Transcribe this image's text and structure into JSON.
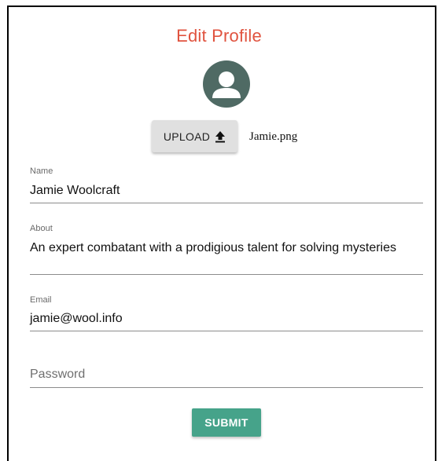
{
  "form": {
    "title": "Edit Profile",
    "avatar_icon": "person-icon",
    "upload_label": "UPLOAD",
    "upload_icon": "upload-arrow-icon",
    "filename": "Jamie.png",
    "fields": {
      "name": {
        "label": "Name",
        "value": "Jamie Woolcraft"
      },
      "about": {
        "label": "About",
        "value": "An expert combatant with a prodigious talent for solving mysteries"
      },
      "email": {
        "label": "Email",
        "value": "jamie@wool.info"
      },
      "password": {
        "placeholder": "Password",
        "value": ""
      }
    },
    "submit_label": "SUBMIT"
  },
  "colors": {
    "title": "#e0533f",
    "avatar_bg": "#4f6a64",
    "submit_bg": "#46a38a",
    "upload_bg": "#e0e0e0"
  }
}
